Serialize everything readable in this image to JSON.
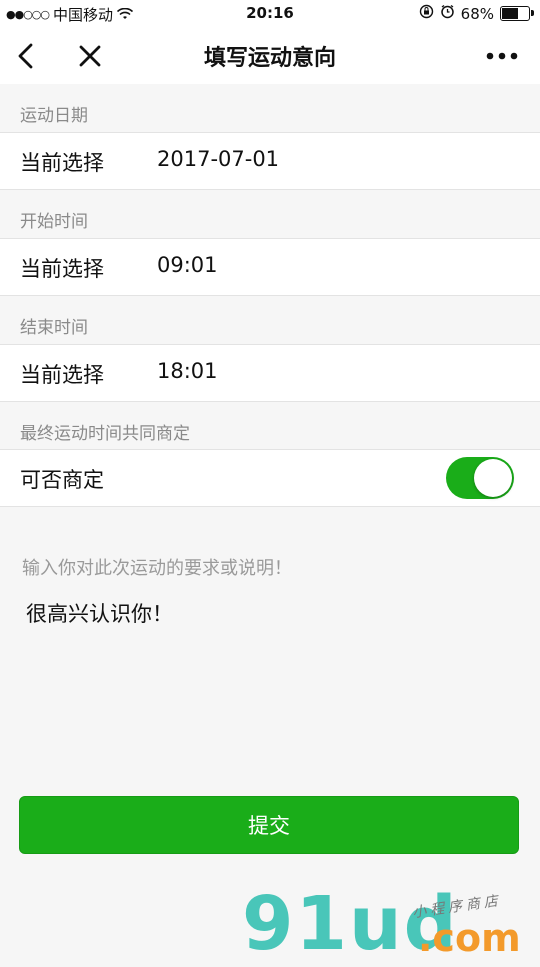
{
  "status_bar": {
    "signal": "●●○○○",
    "carrier": "中国移动",
    "time": "20:16",
    "battery": "68%",
    "battery_level": 0.68
  },
  "navbar": {
    "title": "填写运动意向"
  },
  "sections": [
    {
      "label": "运动日期",
      "row_key": "当前选择",
      "row_value": "2017-07-01"
    },
    {
      "label": "开始时间",
      "row_key": "当前选择",
      "row_value": "09:01"
    },
    {
      "label": "结束时间",
      "row_key": "当前选择",
      "row_value": "18:01"
    }
  ],
  "negotiable": {
    "label": "最终运动时间共同商定",
    "row_key": "可否商定",
    "enabled": true
  },
  "remark": {
    "placeholder": "输入你对此次运动的要求或说明！",
    "value": "很高兴认识你！"
  },
  "submit_label": "提交",
  "watermark": {
    "main": "91ud",
    "suffix": ".com",
    "tagline": "小程序商店"
  },
  "colors": {
    "accent": "#1aad19",
    "background": "#f6f6f6"
  }
}
